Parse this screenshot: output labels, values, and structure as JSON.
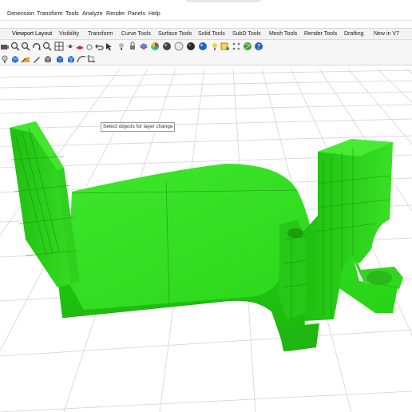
{
  "menubar": {
    "items": [
      "Dimension",
      "Transform",
      "Tools",
      "Analyze",
      "Render",
      "Panels",
      "Help"
    ]
  },
  "tabs": {
    "items": [
      "Viewport Layout",
      "Visibility",
      "Transform",
      "Curve Tools",
      "Surface Tools",
      "Solid Tools",
      "SubD Tools",
      "Mesh Tools",
      "Render Tools",
      "Drafting",
      "New in V7"
    ]
  },
  "toolbar": {
    "row1_icons": [
      "camera-icon",
      "zoom-window-icon",
      "zoom-extents-icon",
      "rotate-view-icon",
      "four-viewports-icon",
      "point-icon",
      "plane-icon",
      "circle-icon",
      "undo-icon",
      "select-icon",
      "bulb-icon",
      "lock-icon",
      "layer-icon",
      "render-sphere-icon",
      "color-wheel-icon",
      "dark-sphere-icon",
      "gray-sphere-icon",
      "blue-sphere-icon",
      "box-icon",
      "plugin-icon",
      "grid-snap-icon",
      "globe-icon",
      "help-icon"
    ],
    "row2_icons": [
      "light-bulb-icon",
      "blue-box-icon",
      "surface-icon",
      "pen-icon",
      "solid-box-icon",
      "blue-cube-icon",
      "blue-cube-2-icon",
      "curve-icon",
      "crop-icon"
    ]
  },
  "viewport": {
    "tooltip": "Select objects for layer change",
    "model_color": "#2ee01f",
    "grid_color": "#d6d6d6"
  }
}
